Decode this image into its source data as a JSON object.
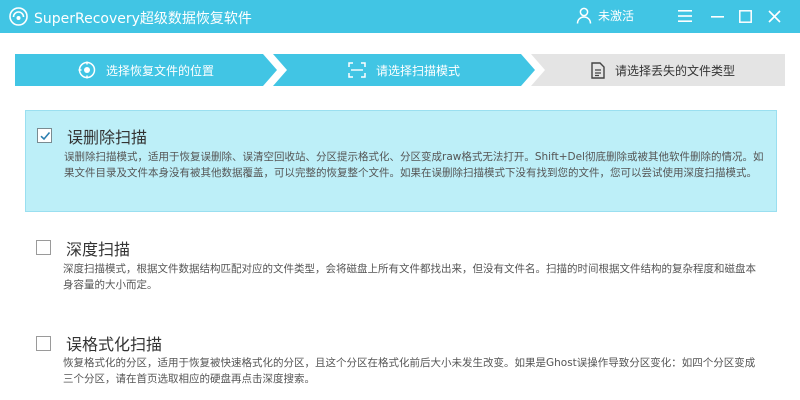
{
  "titlebar": {
    "app_title": "SuperRecovery超级数据恢复软件",
    "user_label": "未激活",
    "icons": [
      "app-logo-icon",
      "user-icon",
      "menu-icon",
      "minimize-icon",
      "maximize-icon",
      "close-icon"
    ],
    "background_color": "#41c5e4"
  },
  "steps": [
    {
      "label": "选择恢复文件的位置",
      "icon": "location-icon",
      "state": "done",
      "color": "#41c5e4"
    },
    {
      "label": "请选择扫描模式",
      "icon": "scan-icon",
      "state": "active",
      "color": "#41c5e4"
    },
    {
      "label": "请选择丢失的文件类型",
      "icon": "document-icon",
      "state": "pending",
      "color": "#e4e4e4"
    }
  ],
  "options": [
    {
      "title": "误删除扫描",
      "checked": true,
      "description": "误删除扫描模式，适用于恢复误删除、误清空回收站、分区提示格式化、分区变成raw格式无法打开。Shift+Del彻底删除或被其他软件删除的情况。如果文件目录及文件本身没有被其他数据覆盖，可以完整的恢复整个文件。如果在误删除扫描模式下没有找到您的文件，您可以尝试使用深度扫描模式。"
    },
    {
      "title": "深度扫描",
      "checked": false,
      "description": "深度扫描模式，根据文件数据结构匹配对应的文件类型，会将磁盘上所有文件都找出来，但没有文件名。扫描的时间根据文件结构的复杂程度和磁盘本身容量的大小而定。"
    },
    {
      "title": "误格式化扫描",
      "checked": false,
      "description": "恢复格式化的分区，适用于恢复被快速格式化的分区，且这个分区在格式化前后大小未发生改变。如果是Ghost误操作导致分区变化：如四个分区变成三个分区，请在首页选取相应的硬盘再点击深度搜索。"
    }
  ],
  "colors": {
    "accent": "#41c5e4",
    "selected_bg": "#bdeff8",
    "pending_step": "#e4e4e4"
  }
}
